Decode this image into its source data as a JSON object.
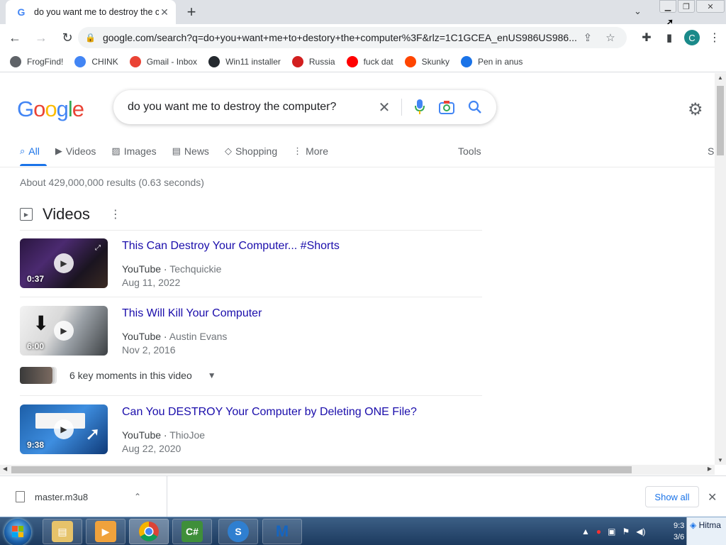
{
  "browser": {
    "tab_title": "do you want me to destroy the c",
    "url": "google.com/search?q=do+you+want+me+to+destory+the+computer%3F&rlz=1C1GCEA_enUS986US986...",
    "profile_initial": "C",
    "bookmarks": [
      {
        "label": "FrogFind!",
        "icon": "frogfind-icon",
        "color": "#5f6368"
      },
      {
        "label": "CHINK",
        "icon": "google-g-icon",
        "color": "#4285f4"
      },
      {
        "label": "Gmail - Inbox",
        "icon": "gmail-icon",
        "color": "#ea4335"
      },
      {
        "label": "Win11 installer",
        "icon": "github-icon",
        "color": "#24292e"
      },
      {
        "label": "Russia",
        "icon": "russia-icon",
        "color": "#d21f1f"
      },
      {
        "label": "fuck dat",
        "icon": "youtube-icon",
        "color": "#ff0000"
      },
      {
        "label": "Skunky",
        "icon": "reddit-icon",
        "color": "#ff4500"
      },
      {
        "label": "Pen in anus",
        "icon": "globe-icon",
        "color": "#1a73e8"
      }
    ]
  },
  "search": {
    "logo": "Google",
    "query": "do you want me to destroy the computer?",
    "tabs": [
      {
        "label": "All",
        "icon": "search-icon",
        "active": true
      },
      {
        "label": "Videos",
        "icon": "video-icon"
      },
      {
        "label": "Images",
        "icon": "image-icon"
      },
      {
        "label": "News",
        "icon": "news-icon"
      },
      {
        "label": "Shopping",
        "icon": "tag-icon"
      },
      {
        "label": "More",
        "icon": "more-vert-icon"
      }
    ],
    "tools_label": "Tools",
    "extra_label": "S",
    "result_stats": "About 429,000,000 results (0.63 seconds)"
  },
  "videos": {
    "heading": "Videos",
    "items": [
      {
        "title": "This Can Destroy Your Computer... #Shorts",
        "source": "YouTube",
        "channel": "Techquickie",
        "date": "Aug 11, 2022",
        "duration": "0:37"
      },
      {
        "title": "This Will Kill Your Computer",
        "source": "YouTube",
        "channel": "Austin Evans",
        "date": "Nov 2, 2016",
        "duration": "6:00"
      },
      {
        "title": "Can You DESTROY Your Computer by Deleting ONE File?",
        "source": "YouTube",
        "channel": "ThioJoe",
        "date": "Aug 22, 2020",
        "duration": "9:38"
      }
    ],
    "key_moments": "6 key moments in this video"
  },
  "downloads": {
    "file": "master.m3u8",
    "show_all": "Show all"
  },
  "taskbar": {
    "clock_time": "9:3",
    "clock_date": "3/6",
    "hitman_label": "Hitma"
  }
}
